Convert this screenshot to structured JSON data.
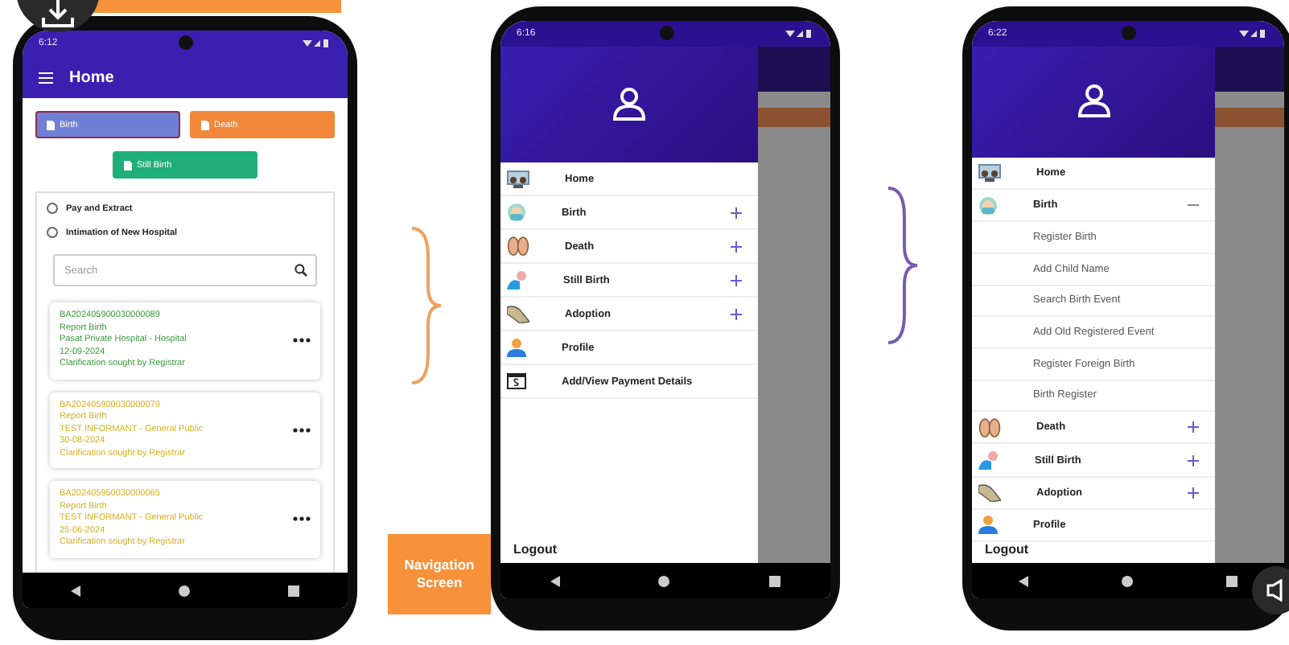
{
  "home_screen": {
    "status_time": "6:12",
    "title": "Home",
    "record_buttons": [
      {
        "label": "Birth",
        "selected": true,
        "color": "#6f7fd6"
      },
      {
        "label": "Death",
        "selected": false,
        "color": "#f2883a"
      },
      {
        "label": "Still Birth",
        "selected": false,
        "color": "#1fae7a"
      }
    ],
    "options": [
      {
        "label": "Pay and Extract",
        "selected": false
      },
      {
        "label": "Intimation of New Hospital",
        "selected": false
      }
    ],
    "search": {
      "placeholder": "Search"
    },
    "records": [
      {
        "id": "BA202405900030000089",
        "type": "Report Birth",
        "party": "Pasat Private Hospital - Hospital",
        "date": "12-09-2024",
        "status": "Clarification sought by Registrar",
        "color": "#3a9a3a"
      },
      {
        "id": "BA202405900030000079",
        "type": "Report Birth",
        "party": "TEST INFORMANT - General Public",
        "date": "30-08-2024",
        "status": "Clarification sought by Registrar",
        "color": "#d4b020"
      },
      {
        "id": "BA202405950030000065",
        "type": "Report Birth",
        "party": "TEST INFORMANT - General Public",
        "date": "25-06-2024",
        "status": "Clarification sought by Registrar",
        "color": "#d4b020"
      }
    ]
  },
  "callout": "Navigation Screen",
  "drawer_screens": [
    {
      "status_time": "6:16",
      "items": [
        {
          "label": "Home",
          "kind": "link"
        },
        {
          "label": "Birth",
          "kind": "group",
          "expanded": false
        },
        {
          "label": "Death",
          "kind": "group",
          "expanded": false
        },
        {
          "label": "Still Birth",
          "kind": "group",
          "expanded": false
        },
        {
          "label": "Adoption",
          "kind": "group",
          "expanded": false
        },
        {
          "label": "Profile",
          "kind": "link"
        },
        {
          "label": "Add/View Payment Details",
          "kind": "link"
        }
      ],
      "logout": "Logout"
    },
    {
      "status_time": "6:22",
      "items": [
        {
          "label": "Home",
          "kind": "link"
        },
        {
          "label": "Birth",
          "kind": "group",
          "expanded": true,
          "children": [
            {
              "label": "Register Birth"
            },
            {
              "label": "Add Child Name"
            },
            {
              "label": "Search Birth Event"
            },
            {
              "label": "Add Old Registered Event"
            },
            {
              "label": "Register Foreign Birth"
            },
            {
              "label": "Birth Register"
            }
          ]
        },
        {
          "label": "Death",
          "kind": "group",
          "expanded": false
        },
        {
          "label": "Still Birth",
          "kind": "group",
          "expanded": false
        },
        {
          "label": "Adoption",
          "kind": "group",
          "expanded": false
        },
        {
          "label": "Profile",
          "kind": "link"
        }
      ],
      "logout": "Logout"
    }
  ]
}
